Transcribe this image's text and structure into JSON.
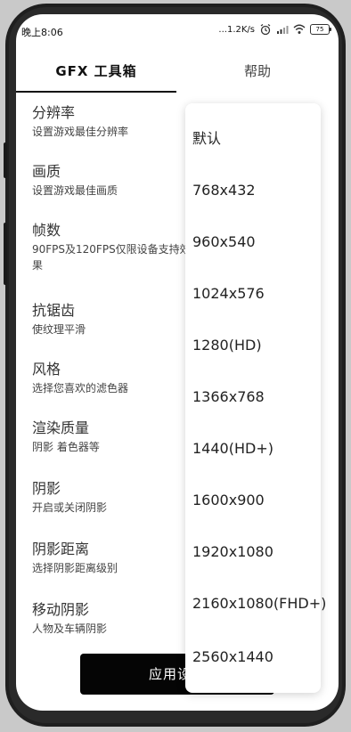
{
  "status_bar": {
    "time": "晚上8:06",
    "net_speed": "...1.2K/s",
    "battery": "75"
  },
  "tabs": [
    {
      "label": "GFX 工具箱",
      "active": true
    },
    {
      "label": "帮助",
      "active": false
    }
  ],
  "settings": [
    {
      "title": "分辨率",
      "desc": "设置游戏最佳分辨率"
    },
    {
      "title": "画质",
      "desc": "设置游戏最佳画质"
    },
    {
      "title": "帧数",
      "desc": "90FPS及120FPS仅限设备支持效果"
    },
    {
      "title": "抗锯齿",
      "desc": "使纹理平滑"
    },
    {
      "title": "风格",
      "desc": "选择您喜欢的滤色器"
    },
    {
      "title": "渲染质量",
      "desc": "阴影 着色器等"
    },
    {
      "title": "阴影",
      "desc": "开启或关闭阴影"
    },
    {
      "title": "阴影距离",
      "desc": "选择阴影距离级别"
    },
    {
      "title": "移动阴影",
      "desc": "人物及车辆阴影"
    }
  ],
  "apply_button": "应用设置",
  "resolution_options": [
    "默认",
    "768x432",
    "960x540",
    "1024x576",
    "1280(HD)",
    "1366x768",
    "1440(HD+)",
    "1600x900",
    "1920x1080",
    "2160x1080(FHD+)",
    "2560x1440"
  ]
}
